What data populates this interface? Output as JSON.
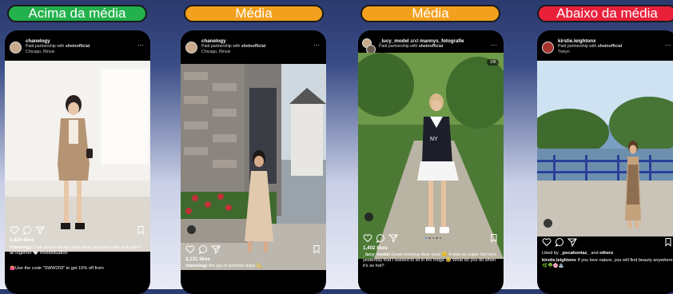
{
  "badges": [
    {
      "label": "Acima da média",
      "color": "#22b14c"
    },
    {
      "label": "Média",
      "color": "#f2a01d"
    },
    {
      "label": "Média",
      "color": "#f2a01d"
    },
    {
      "label": "Abaixo da média",
      "color": "#e8203a"
    }
  ],
  "posts": [
    {
      "username": "chanelogy",
      "partnership_prefix": "Paid partnership with ",
      "partner": "sheinofficial",
      "location": "Chicago, Illinois",
      "more": "···",
      "likes": "2,824 likes",
      "caption_user": "chanelogy",
      "caption_text": " Cute shoes always help bring out your outfit and pull it all together 🤍 #ootdsituation",
      "caption_extra": "👛Use the code \"SWW203\" to get 15% off from"
    },
    {
      "username": "chanelogy",
      "partnership_prefix": "Paid partnership with ",
      "partner": "sheinofficial",
      "location": "Chicago, Illinois",
      "more": "···",
      "likes": "3,131 likes",
      "caption_user": "chanelogy",
      "caption_text": " the joy of summer days 💫"
    },
    {
      "username_a": "_lucy_model",
      "username_join": " and ",
      "username_b": "mannys_fotografie",
      "partnership_prefix": "Paid partnership with ",
      "partner": "sheinofficial",
      "more": "···",
      "counter": "1/8",
      "likes": "1,402 likes",
      "caption_user": "_lucy_model",
      "caption_text": " Good morning dear ones 😊 It was so super hot here yesterday that I wanted to sit in the fridge 😂 What do you do when it's so hot?"
    },
    {
      "username": "kirstie.leightonx",
      "partnership_prefix": "Paid partnership with ",
      "partner": "sheinofficial",
      "location": "Towyn",
      "more": "···",
      "liked_by_prefix": "Liked by ",
      "liked_by_user": "_pocahontaz_",
      "liked_by_suffix": " and ",
      "liked_by_others": "others",
      "caption_user": "kirstie.leightonx",
      "caption_text": " If you love nature, you will find beauty anywhere🌿🌳🌸⛲"
    }
  ],
  "icons": [
    "heart-icon",
    "comment-icon",
    "share-icon",
    "bookmark-icon",
    "user-tag-icon"
  ]
}
